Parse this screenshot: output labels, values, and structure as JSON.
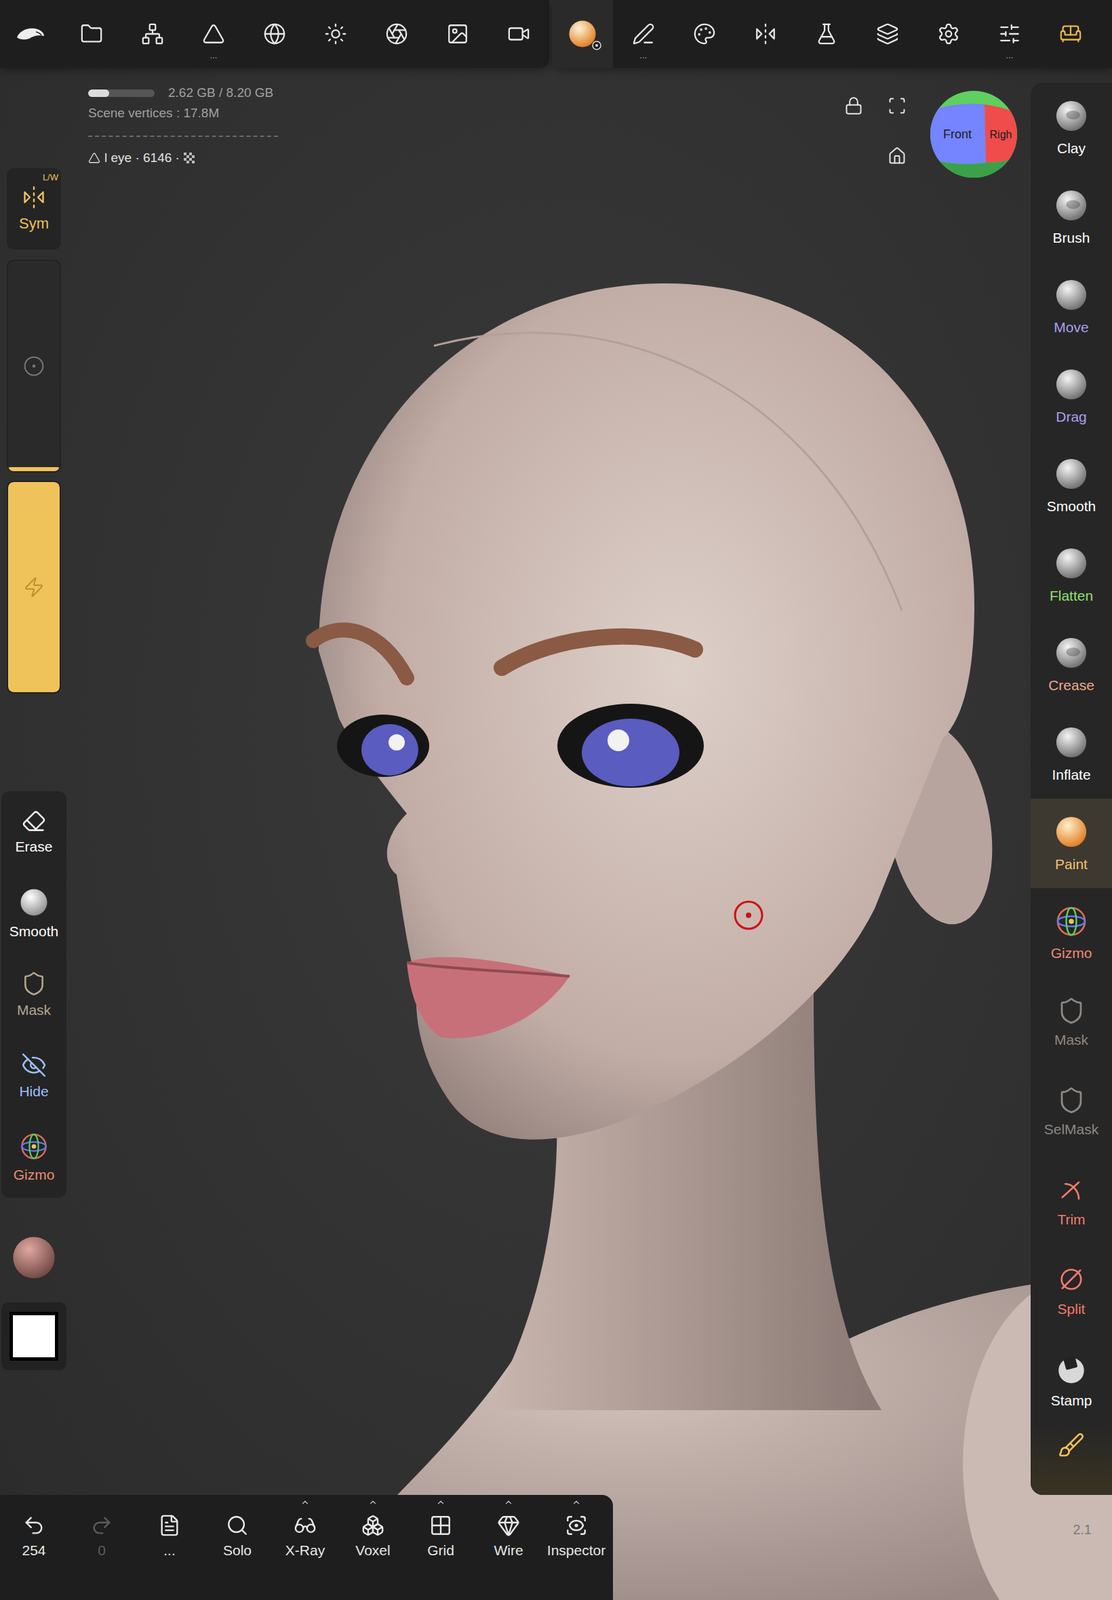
{
  "top_toolbar": {
    "items": [
      {
        "selected": false,
        "accent": false
      },
      {
        "selected": false,
        "accent": false
      },
      {
        "selected": false,
        "accent": false
      },
      {
        "selected": false,
        "accent": false,
        "more": "..."
      },
      {
        "selected": false,
        "accent": false
      },
      {
        "selected": false,
        "accent": false
      },
      {
        "selected": false,
        "accent": false
      },
      {
        "selected": false,
        "accent": false
      },
      {
        "selected": false,
        "accent": false
      },
      {
        "selected": true,
        "accent": false
      },
      {
        "selected": false,
        "accent": false,
        "more": "..."
      },
      {
        "selected": false,
        "accent": false
      },
      {
        "selected": false,
        "accent": false
      },
      {
        "selected": false,
        "accent": false
      },
      {
        "selected": false,
        "accent": false
      },
      {
        "selected": false,
        "accent": false
      },
      {
        "selected": false,
        "accent": false,
        "more": "..."
      },
      {
        "selected": false,
        "accent": true
      }
    ]
  },
  "memory": {
    "text": "2.62 GB / 8.20 GB",
    "level": 0.32
  },
  "scene_vertices": "Scene vertices : 17.8M",
  "object": {
    "name": "l eye · 6146 ·"
  },
  "view_gizmo": {
    "front": "Front",
    "right": "Righ"
  },
  "symmetry": {
    "label": "Sym",
    "badge": "L/W",
    "on": true
  },
  "radius_slider": {
    "level": 0.02
  },
  "intensity_slider": {
    "level": 1.0
  },
  "left_tools": [
    {
      "label": "Erase",
      "kind": "erase",
      "color": "#ffffff"
    },
    {
      "label": "Smooth",
      "kind": "sphere",
      "color": "#ffffff"
    },
    {
      "label": "Mask",
      "kind": "mask",
      "color": "#b3a492"
    },
    {
      "label": "Hide",
      "kind": "hide",
      "color": "#9cc0ff"
    },
    {
      "label": "Gizmo",
      "kind": "gizmo",
      "color": "#ec8c76"
    }
  ],
  "color_swatch": {
    "color": "#ffffff"
  },
  "right_tools": [
    {
      "label": "Clay",
      "kind": "sphere",
      "color": "#ffffff",
      "selected": false
    },
    {
      "label": "Brush",
      "kind": "sphere",
      "color": "#ffffff",
      "selected": false
    },
    {
      "label": "Move",
      "kind": "sphere",
      "color": "#aa9ff2",
      "selected": false
    },
    {
      "label": "Drag",
      "kind": "sphere",
      "color": "#aa9ff2",
      "selected": false
    },
    {
      "label": "Smooth",
      "kind": "sphere",
      "color": "#ffffff",
      "selected": false
    },
    {
      "label": "Flatten",
      "kind": "sphere",
      "color": "#92e070",
      "selected": false
    },
    {
      "label": "Crease",
      "kind": "sphere",
      "color": "#f2a68c",
      "selected": false
    },
    {
      "label": "Inflate",
      "kind": "sphere",
      "color": "#ffffff",
      "selected": false
    },
    {
      "label": "Paint",
      "kind": "paint",
      "color": "#f2c274",
      "selected": true
    },
    {
      "label": "Gizmo",
      "kind": "gizmo",
      "color": "#f08c72",
      "selected": false
    },
    {
      "label": "Mask",
      "kind": "mask",
      "color": "#8e8782",
      "selected": false
    },
    {
      "label": "SelMask",
      "kind": "selmask",
      "color": "#8e8782",
      "selected": false
    },
    {
      "label": "Trim",
      "kind": "trim",
      "color": "#f27c6c",
      "selected": false
    },
    {
      "label": "Split",
      "kind": "split",
      "color": "#f27c6c",
      "selected": false
    },
    {
      "label": "Stamp",
      "kind": "stamp",
      "color": "#ffffff",
      "selected": false
    }
  ],
  "bottom_toolbar": [
    {
      "label": "254",
      "kind": "undo",
      "disabled": false,
      "caret": false
    },
    {
      "label": "0",
      "kind": "redo",
      "disabled": true,
      "caret": false
    },
    {
      "label": "...",
      "kind": "notes",
      "disabled": false,
      "caret": false
    },
    {
      "label": "Solo",
      "kind": "solo",
      "disabled": false,
      "caret": false
    },
    {
      "label": "X-Ray",
      "kind": "xray",
      "disabled": false,
      "caret": true
    },
    {
      "label": "Voxel",
      "kind": "voxel",
      "disabled": false,
      "caret": true
    },
    {
      "label": "Grid",
      "kind": "grid",
      "disabled": false,
      "caret": true
    },
    {
      "label": "Wire",
      "kind": "wire",
      "disabled": false,
      "caret": true
    },
    {
      "label": "Inspector",
      "kind": "inspector",
      "disabled": false,
      "caret": true
    }
  ],
  "version": "2.1"
}
